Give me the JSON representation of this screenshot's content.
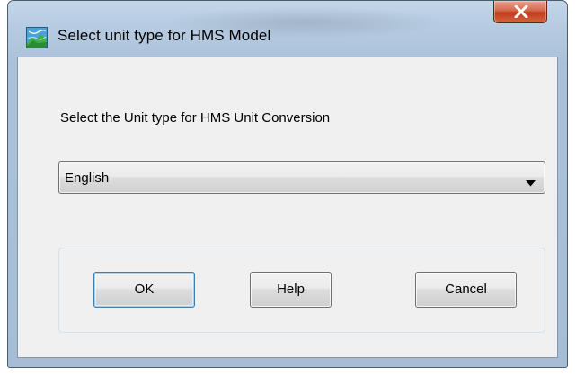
{
  "window": {
    "title": "Select unit type for HMS Model",
    "app_icon": "watershed-map-icon",
    "close_icon": "close-x-icon"
  },
  "dialog": {
    "prompt": "Select the Unit type for HMS Unit Conversion",
    "unit_select": {
      "selected": "English",
      "arrow_icon": "chevron-down-icon"
    },
    "buttons": {
      "ok": "OK",
      "help": "Help",
      "cancel": "Cancel"
    }
  },
  "colors": {
    "frame": "#b6cbe1",
    "client": "#f0f0f0",
    "close_button": "#c13b1c"
  }
}
